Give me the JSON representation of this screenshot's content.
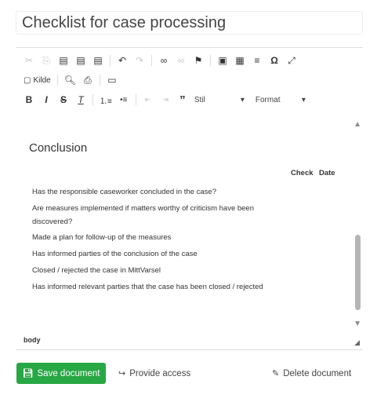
{
  "title": "Checklist for case processing",
  "toolbar": {
    "row1": [
      {
        "icon": "cut-icon",
        "glyph": "✂",
        "enabled": false
      },
      {
        "icon": "copy-icon",
        "glyph": "⎘",
        "enabled": false
      },
      {
        "icon": "paste-icon",
        "glyph": "📋",
        "enabled": true
      },
      {
        "icon": "paste-text-icon",
        "glyph": "📋",
        "enabled": true
      },
      {
        "icon": "paste-word-icon",
        "glyph": "📋",
        "enabled": true
      },
      {
        "icon": "undo-icon",
        "glyph": "↶",
        "enabled": true
      },
      {
        "icon": "redo-icon",
        "glyph": "↷",
        "enabled": false
      },
      {
        "icon": "link-icon",
        "glyph": "🔗",
        "enabled": true
      },
      {
        "icon": "unlink-icon",
        "glyph": "⛓",
        "enabled": false
      },
      {
        "icon": "anchor-icon",
        "glyph": "⚑",
        "enabled": true
      },
      {
        "icon": "image-icon",
        "glyph": "▣",
        "enabled": true
      },
      {
        "icon": "table-icon",
        "glyph": "▦",
        "enabled": true
      },
      {
        "icon": "horizontal-line-icon",
        "glyph": "≡",
        "enabled": true
      },
      {
        "icon": "special-char-icon",
        "glyph": "Ω",
        "enabled": true
      },
      {
        "icon": "maximize-icon",
        "glyph": "⤢",
        "enabled": true
      }
    ],
    "source_label": "Kilde",
    "styles_label": "Stil",
    "format_label": "Format"
  },
  "content": {
    "heading": "Conclusion",
    "col_check": "Check",
    "col_date": "Date",
    "rows": [
      "Has the responsible caseworker concluded in the case?",
      "Are measures implemented if matters worthy of criticism have been discovered?",
      "Made a plan for follow-up of the measures",
      "Has informed parties of the conclusion of the case",
      "Closed / rejected the case in MittVarsel",
      "Has informed relevant parties that the case has been closed / rejected"
    ]
  },
  "status_path": "body",
  "actions": {
    "save": "Save document",
    "access": "Provide access",
    "delete": "Delete document"
  },
  "colors": {
    "save_button": "#28a745"
  }
}
